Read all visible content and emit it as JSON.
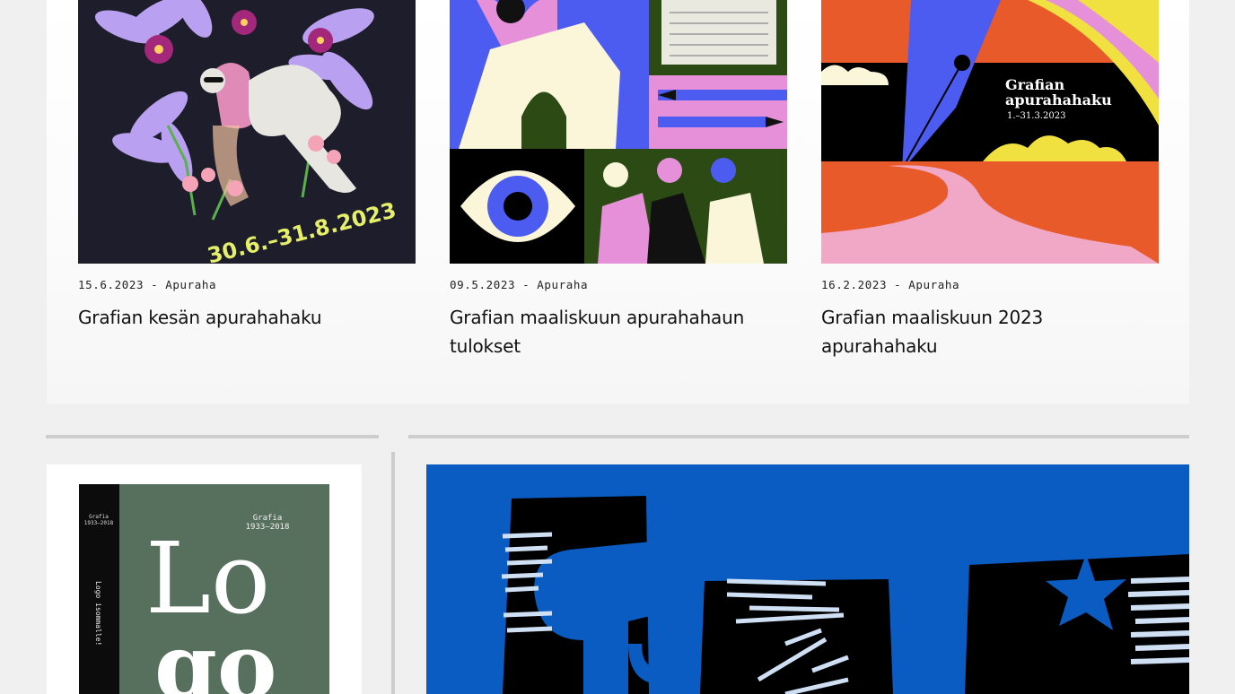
{
  "news": [
    {
      "date": "15.6.2023",
      "category": "Apuraha",
      "title": "Grafian kesän apurahahaku",
      "image_text": "30.6.–31.8.2023"
    },
    {
      "date": "09.5.2023",
      "category": "Apuraha",
      "title": "Grafian maaliskuun apurahahaun tulokset"
    },
    {
      "date": "16.2.2023",
      "category": "Apuraha",
      "title": "Grafian maaliskuun 2023 apurahahaku",
      "image_title": [
        "Grafian",
        "apurahahaku"
      ],
      "image_subtitle": "1.–31.3.2023"
    }
  ],
  "separator": "-",
  "book": {
    "spine_top": [
      "Grafia",
      "1933–2018"
    ],
    "spine_text": "Logo isommalle!",
    "cover_top": [
      "Grafia",
      "1933–2018"
    ],
    "cover_big": [
      "Lo",
      "go"
    ]
  },
  "colors": {
    "panel_bg": "#ffffff",
    "page_bg": "#f0f0f0",
    "rule": "#cdcdcd",
    "accent_blue": "#0a5cc2",
    "violet": "#b9a0f0"
  }
}
